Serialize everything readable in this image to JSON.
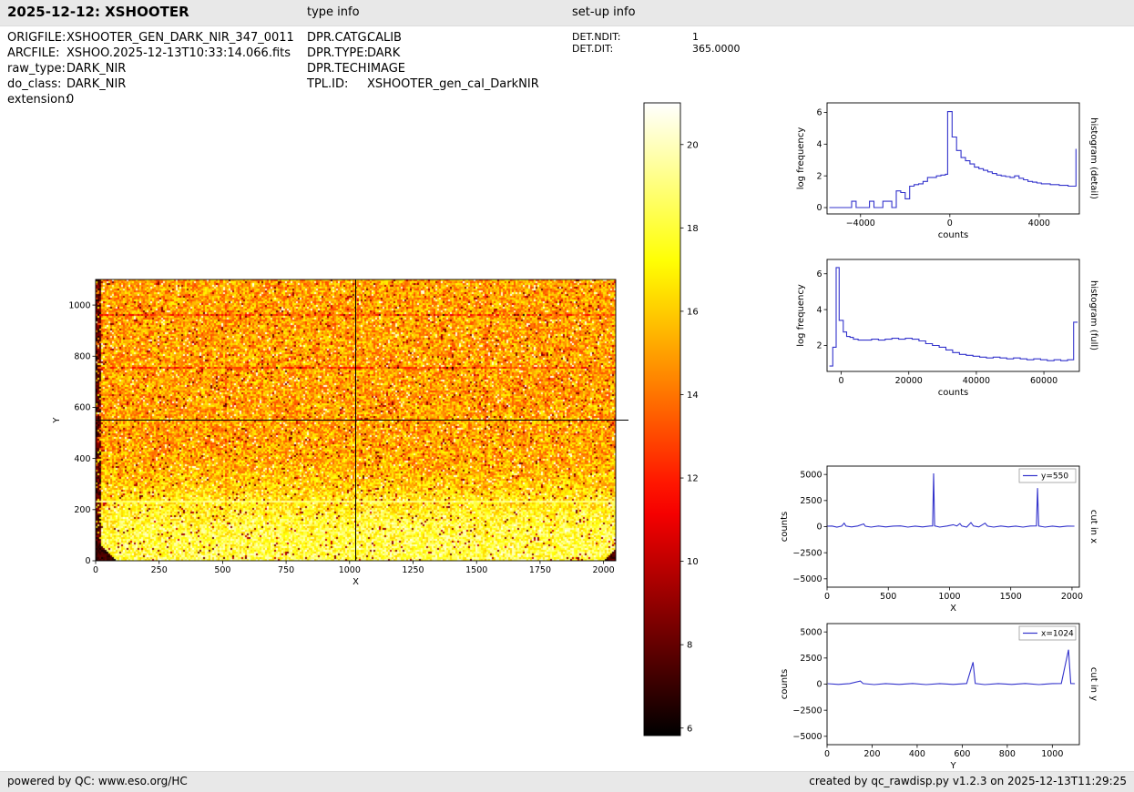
{
  "header": {
    "title": "2025-12-12: XSHOOTER",
    "type_info": "type info",
    "setup_info": "set-up info"
  },
  "metadata": {
    "file": [
      {
        "label": "ORIGFILE:",
        "value": "XSHOOTER_GEN_DARK_NIR_347_0011"
      },
      {
        "label": "ARCFILE:",
        "value": "XSHOO.2025-12-13T10:33:14.066.fits"
      },
      {
        "label": "raw_type:",
        "value": "DARK_NIR"
      },
      {
        "label": "do_class:",
        "value": "DARK_NIR"
      },
      {
        "label": "extension:",
        "value": "0"
      }
    ],
    "type": [
      {
        "label": "DPR.CATG:",
        "value": "CALIB"
      },
      {
        "label": "DPR.TYPE:",
        "value": "DARK"
      },
      {
        "label": "DPR.TECH:",
        "value": "IMAGE"
      },
      {
        "label": "TPL.ID:",
        "value": "XSHOOTER_gen_cal_DarkNIR"
      }
    ],
    "setup": [
      {
        "label": "DET.NDIT:",
        "value": "1"
      },
      {
        "label": "DET.DIT:",
        "value": "365.0000"
      }
    ]
  },
  "footer": {
    "left": "powered by QC: www.eso.org/HC",
    "right": "created by qc_rawdisp.py v1.2.3 on 2025-12-13T11:29:25"
  },
  "colors": {
    "line_blue": "#3333cc",
    "band_gray": "#e8e8e8",
    "frame_black": "#000000"
  },
  "chart_data": [
    {
      "type": "heatmap",
      "name": "raw-image",
      "description": "XSHOOTER NIR raw dark frame; mostly 14-16 counts (orange/red), brighter ~18-20 (yellow) below y~250, dark left edge and bottom-left/bottom-right corners, bright row near y=232, crosshair cut lines at x=1024 and y=550",
      "xlabel": "X",
      "ylabel": "Y",
      "xlim": [
        0,
        2048
      ],
      "ylim": [
        0,
        1100
      ],
      "xticks": [
        0,
        250,
        500,
        750,
        1000,
        1250,
        1500,
        1750,
        2000
      ],
      "yticks": [
        0,
        200,
        400,
        600,
        800,
        1000
      ],
      "value_range": [
        6,
        21
      ],
      "colormap": "hot",
      "crosshair": {
        "x": 1024,
        "y": 550
      },
      "generator": {
        "seed": 77,
        "base_level": 15.0,
        "base_amp": 3.2,
        "base_mid": 255,
        "base_width": 60,
        "noise": 2.1,
        "bright_row": 232,
        "dark_rows": [
          963,
          756
        ],
        "seam_cols": [
          512,
          1536
        ]
      }
    },
    {
      "type": "colorbar",
      "name": "colorbar",
      "colormap": "hot",
      "value_range": [
        5.82,
        21.0
      ],
      "ticks": [
        6,
        8,
        10,
        12,
        14,
        16,
        18,
        20
      ]
    },
    {
      "type": "step",
      "name": "histogram-detail",
      "side_label": "histogram (detail)",
      "xlabel": "counts",
      "ylabel": "log frequency",
      "xlim": [
        -5500,
        5800
      ],
      "ylim": [
        -0.4,
        6.6
      ],
      "xticks": [
        -4000,
        0,
        4000
      ],
      "yticks": [
        0,
        2,
        4,
        6
      ],
      "x": [
        -5400,
        -4600,
        -4400,
        -4200,
        -4000,
        -3800,
        -3600,
        -3400,
        -3200,
        -3000,
        -2800,
        -2600,
        -2400,
        -2200,
        -2000,
        -1800,
        -1600,
        -1400,
        -1200,
        -1000,
        -800,
        -600,
        -400,
        -200,
        -100,
        100,
        300,
        500,
        700,
        900,
        1100,
        1300,
        1500,
        1700,
        1900,
        2100,
        2300,
        2500,
        2700,
        2900,
        3100,
        3300,
        3500,
        3700,
        3900,
        4100,
        4300,
        4500,
        4700,
        4900,
        5100,
        5300,
        5500,
        5650
      ],
      "y": [
        0,
        0,
        0.4,
        0,
        0,
        0,
        0.4,
        0,
        0,
        0.4,
        0.4,
        0,
        1.05,
        0.95,
        0.55,
        1.35,
        1.45,
        1.5,
        1.65,
        1.9,
        1.9,
        2.0,
        2.05,
        2.1,
        6.05,
        4.45,
        3.6,
        3.15,
        2.95,
        2.75,
        2.55,
        2.45,
        2.35,
        2.25,
        2.15,
        2.05,
        2.0,
        1.95,
        1.9,
        2.0,
        1.85,
        1.75,
        1.65,
        1.6,
        1.55,
        1.5,
        1.5,
        1.45,
        1.45,
        1.4,
        1.4,
        1.35,
        1.35,
        3.7
      ]
    },
    {
      "type": "step",
      "name": "histogram-full",
      "side_label": "histogram (full)",
      "xlabel": "counts",
      "ylabel": "log frequency",
      "xlim": [
        -4200,
        70500
      ],
      "ylim": [
        0.55,
        6.8
      ],
      "xticks": [
        0,
        20000,
        40000,
        60000
      ],
      "yticks": [
        2,
        4,
        6
      ],
      "x": [
        -3500,
        -2500,
        -1500,
        -600,
        600,
        1600,
        2600,
        3600,
        5000,
        7000,
        9000,
        11000,
        13000,
        15000,
        17000,
        19000,
        21000,
        23000,
        25000,
        27000,
        29000,
        31000,
        33000,
        35000,
        37000,
        39000,
        41000,
        43000,
        45000,
        47000,
        49000,
        51000,
        53000,
        55000,
        57000,
        59000,
        61000,
        63000,
        65000,
        67000,
        68800,
        70000
      ],
      "y": [
        0.85,
        1.9,
        6.35,
        3.4,
        2.75,
        2.5,
        2.45,
        2.35,
        2.3,
        2.3,
        2.35,
        2.3,
        2.35,
        2.4,
        2.35,
        2.4,
        2.35,
        2.25,
        2.1,
        2.0,
        1.9,
        1.75,
        1.6,
        1.5,
        1.45,
        1.4,
        1.35,
        1.3,
        1.35,
        1.3,
        1.25,
        1.3,
        1.25,
        1.2,
        1.25,
        1.2,
        1.15,
        1.2,
        1.15,
        1.2,
        3.3,
        3.3
      ]
    },
    {
      "type": "line",
      "name": "cut-in-x",
      "side_label": "cut in x",
      "legend": "y=550",
      "xlabel": "X",
      "ylabel": "counts",
      "xlim": [
        0,
        2060
      ],
      "ylim": [
        -5800,
        5800
      ],
      "xticks": [
        0,
        500,
        1000,
        1500,
        2000
      ],
      "yticks": [
        -5000,
        -2500,
        0,
        2500,
        5000
      ],
      "points": [
        [
          3,
          40
        ],
        [
          40,
          60
        ],
        [
          80,
          -40
        ],
        [
          120,
          50
        ],
        [
          140,
          330
        ],
        [
          155,
          50
        ],
        [
          200,
          -30
        ],
        [
          250,
          60
        ],
        [
          300,
          260
        ],
        [
          312,
          40
        ],
        [
          360,
          -40
        ],
        [
          420,
          60
        ],
        [
          480,
          -30
        ],
        [
          540,
          50
        ],
        [
          600,
          70
        ],
        [
          660,
          -40
        ],
        [
          720,
          50
        ],
        [
          780,
          -30
        ],
        [
          840,
          60
        ],
        [
          862,
          70
        ],
        [
          870,
          5100
        ],
        [
          878,
          70
        ],
        [
          920,
          -40
        ],
        [
          980,
          60
        ],
        [
          1030,
          180
        ],
        [
          1060,
          60
        ],
        [
          1085,
          300
        ],
        [
          1100,
          60
        ],
        [
          1140,
          -40
        ],
        [
          1175,
          380
        ],
        [
          1195,
          60
        ],
        [
          1240,
          -30
        ],
        [
          1290,
          330
        ],
        [
          1310,
          50
        ],
        [
          1360,
          -40
        ],
        [
          1420,
          60
        ],
        [
          1480,
          -30
        ],
        [
          1540,
          50
        ],
        [
          1600,
          -40
        ],
        [
          1660,
          60
        ],
        [
          1710,
          70
        ],
        [
          1719,
          3700
        ],
        [
          1728,
          60
        ],
        [
          1780,
          -40
        ],
        [
          1840,
          50
        ],
        [
          1900,
          -30
        ],
        [
          1960,
          50
        ],
        [
          2020,
          40
        ]
      ]
    },
    {
      "type": "line",
      "name": "cut-in-y",
      "side_label": "cut in y",
      "legend": "x=1024",
      "xlabel": "Y",
      "ylabel": "counts",
      "xlim": [
        0,
        1120
      ],
      "ylim": [
        -5800,
        5800
      ],
      "xticks": [
        0,
        200,
        400,
        600,
        800,
        1000
      ],
      "yticks": [
        -5000,
        -2500,
        0,
        2500,
        5000
      ],
      "points": [
        [
          3,
          40
        ],
        [
          50,
          -30
        ],
        [
          100,
          50
        ],
        [
          148,
          300
        ],
        [
          160,
          50
        ],
        [
          210,
          -40
        ],
        [
          260,
          50
        ],
        [
          320,
          -30
        ],
        [
          380,
          60
        ],
        [
          440,
          -40
        ],
        [
          500,
          50
        ],
        [
          560,
          -30
        ],
        [
          620,
          60
        ],
        [
          648,
          2100
        ],
        [
          658,
          60
        ],
        [
          700,
          -40
        ],
        [
          760,
          50
        ],
        [
          820,
          -30
        ],
        [
          880,
          60
        ],
        [
          940,
          -40
        ],
        [
          1000,
          50
        ],
        [
          1040,
          60
        ],
        [
          1072,
          3300
        ],
        [
          1082,
          60
        ],
        [
          1100,
          40
        ]
      ]
    }
  ]
}
